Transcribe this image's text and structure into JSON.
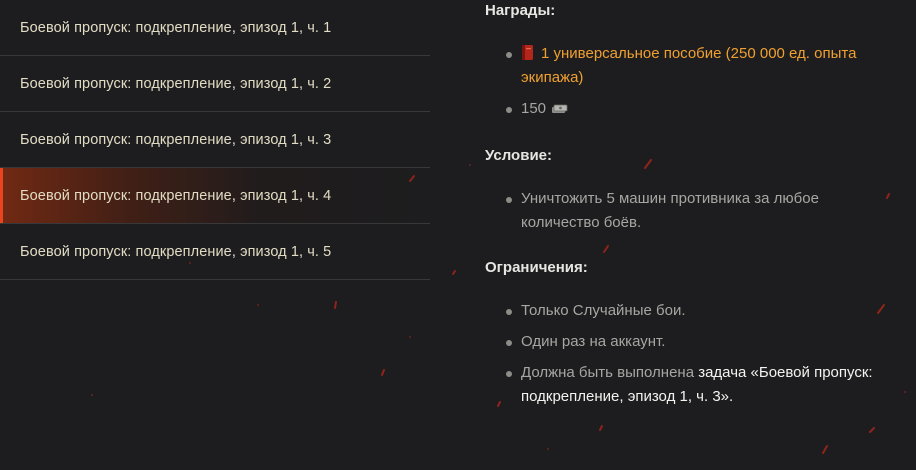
{
  "tasks": [
    {
      "label": "Боевой пропуск: подкрепление, эпизод 1, ч. 1",
      "active": false
    },
    {
      "label": "Боевой пропуск: подкрепление, эпизод 1, ч. 2",
      "active": false
    },
    {
      "label": "Боевой пропуск: подкрепление, эпизод 1, ч. 3",
      "active": false
    },
    {
      "label": "Боевой пропуск: подкрепление, эпизод 1, ч. 4",
      "active": true
    },
    {
      "label": "Боевой пропуск: подкрепление, эпизод 1, ч. 5",
      "active": false
    }
  ],
  "rewards": {
    "title": "Награды:",
    "items": [
      {
        "text": "1 универсальное пособие (250 000 ед. опыта экипажа)",
        "icon": "book-icon",
        "highlight_color": "#f0a030"
      },
      {
        "text": "150",
        "icon": "credits-icon"
      }
    ]
  },
  "condition": {
    "title": "Условие:",
    "items": [
      {
        "text": "Уничтожить 5 машин противника за любое количество боёв."
      }
    ]
  },
  "restrictions": {
    "title": "Ограничения:",
    "items": [
      {
        "text": "Только Случайные бои."
      },
      {
        "text": "Один раз на аккаунт."
      },
      {
        "prefix": "Должна быть выполнена ",
        "strong": "задача «Боевой пропуск: подкрепление, эпизод 1, ч. 3»",
        "suffix": "."
      }
    ]
  },
  "colors": {
    "active_accent": "#e8451e",
    "background": "#1d1d1f",
    "reward_highlight": "#f0a030"
  }
}
